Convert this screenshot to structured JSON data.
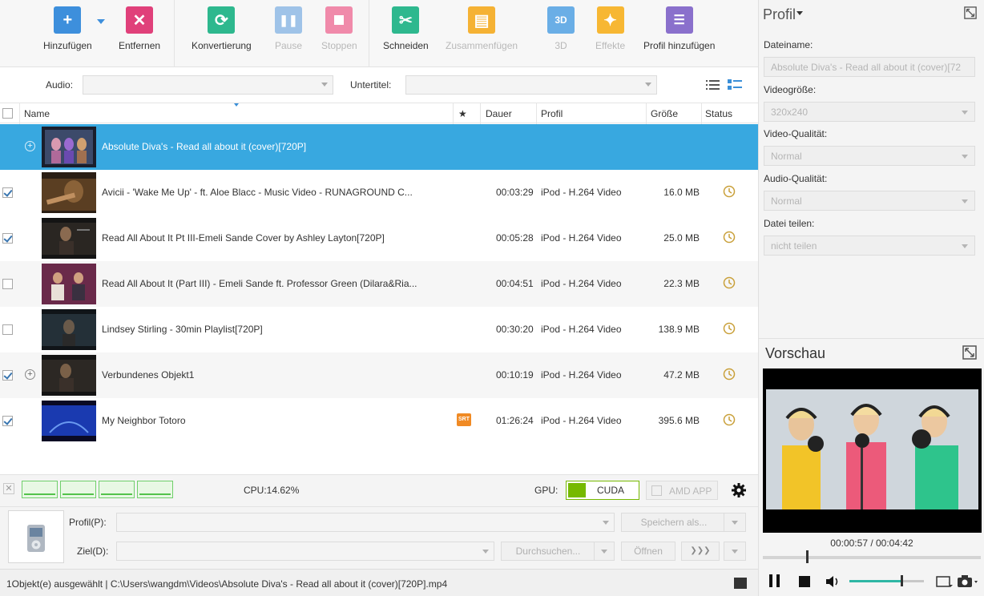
{
  "toolbar": {
    "add": "Hinzufügen",
    "remove": "Entfernen",
    "convert": "Konvertierung",
    "pause": "Pause",
    "stop": "Stoppen",
    "cut": "Schneiden",
    "merge": "Zusammenfügen",
    "threed": "3D",
    "effects": "Effekte",
    "add_profile": "Profil hinzufügen"
  },
  "filters": {
    "audio_label": "Audio:",
    "subtitle_label": "Untertitel:"
  },
  "table": {
    "headers": {
      "name": "Name",
      "star": "★",
      "duration": "Dauer",
      "profile": "Profil",
      "size": "Größe",
      "status": "Status"
    },
    "rows": [
      {
        "name": "Absolute Diva's - Read all about it (cover)[720P]",
        "duration": "",
        "profile": "",
        "size": "",
        "checked": false,
        "selected": true,
        "expandable": true
      },
      {
        "name": "Avicii - 'Wake Me Up' - ft. Aloe Blacc - Music Video - RUNAGROUND C...",
        "duration": "00:03:29",
        "profile": "iPod - H.264 Video",
        "size": "16.0 MB",
        "checked": true
      },
      {
        "name": "Read All About It Pt III-Emeli Sande Cover by Ashley Layton[720P]",
        "duration": "00:05:28",
        "profile": "iPod - H.264 Video",
        "size": "25.0 MB",
        "checked": true
      },
      {
        "name": "Read All About It (Part III) - Emeli Sande ft. Professor Green (Dilara&Ria...",
        "duration": "00:04:51",
        "profile": "iPod - H.264 Video",
        "size": "22.3 MB",
        "checked": false
      },
      {
        "name": "Lindsey Stirling - 30min Playlist[720P]",
        "duration": "00:30:20",
        "profile": "iPod - H.264 Video",
        "size": "138.9 MB",
        "checked": false
      },
      {
        "name": "Verbundenes Objekt1",
        "duration": "00:10:19",
        "profile": "iPod - H.264 Video",
        "size": "47.2 MB",
        "checked": true,
        "expandable": true
      },
      {
        "name": "My Neighbor Totoro",
        "duration": "01:26:24",
        "profile": "iPod - H.264 Video",
        "size": "395.6 MB",
        "checked": true,
        "badge": "SRT"
      }
    ]
  },
  "cpu": {
    "text": "CPU:14.62%",
    "gpu_label": "GPU:",
    "cuda": "CUDA",
    "amd": "AMD APP"
  },
  "output": {
    "profile_label": "Profil(P):",
    "save_as": "Speichern als...",
    "target_label": "Ziel(D):",
    "browse": "Durchsuchen...",
    "open": "Öffnen",
    "arrows": "❯❯❯"
  },
  "status": {
    "text": "1Objekt(e) ausgewählt | C:\\Users\\wangdm\\Videos\\Absolute Diva's - Read all about it (cover)[720P].mp4"
  },
  "profile_panel": {
    "title": "Profil",
    "filename_label": "Dateiname:",
    "filename_value": "Absolute Diva's - Read all about it (cover)[72",
    "videosize_label": "Videogröße:",
    "videosize_value": "320x240",
    "videoquality_label": "Video-Qualität:",
    "videoquality_value": "Normal",
    "audioquality_label": "Audio-Qualität:",
    "audioquality_value": "Normal",
    "split_label": "Datei teilen:",
    "split_value": "nicht teilen"
  },
  "preview": {
    "title": "Vorschau",
    "time": "00:00:57 / 00:04:42",
    "progress": 0.2,
    "volume": 0.71
  },
  "colors": {
    "accent_blue": "#38a8e0",
    "add_blue": "#3d8fdc",
    "remove_pink": "#e0407a",
    "convert_green": "#2eb88e",
    "cuda_green": "#76b900"
  }
}
